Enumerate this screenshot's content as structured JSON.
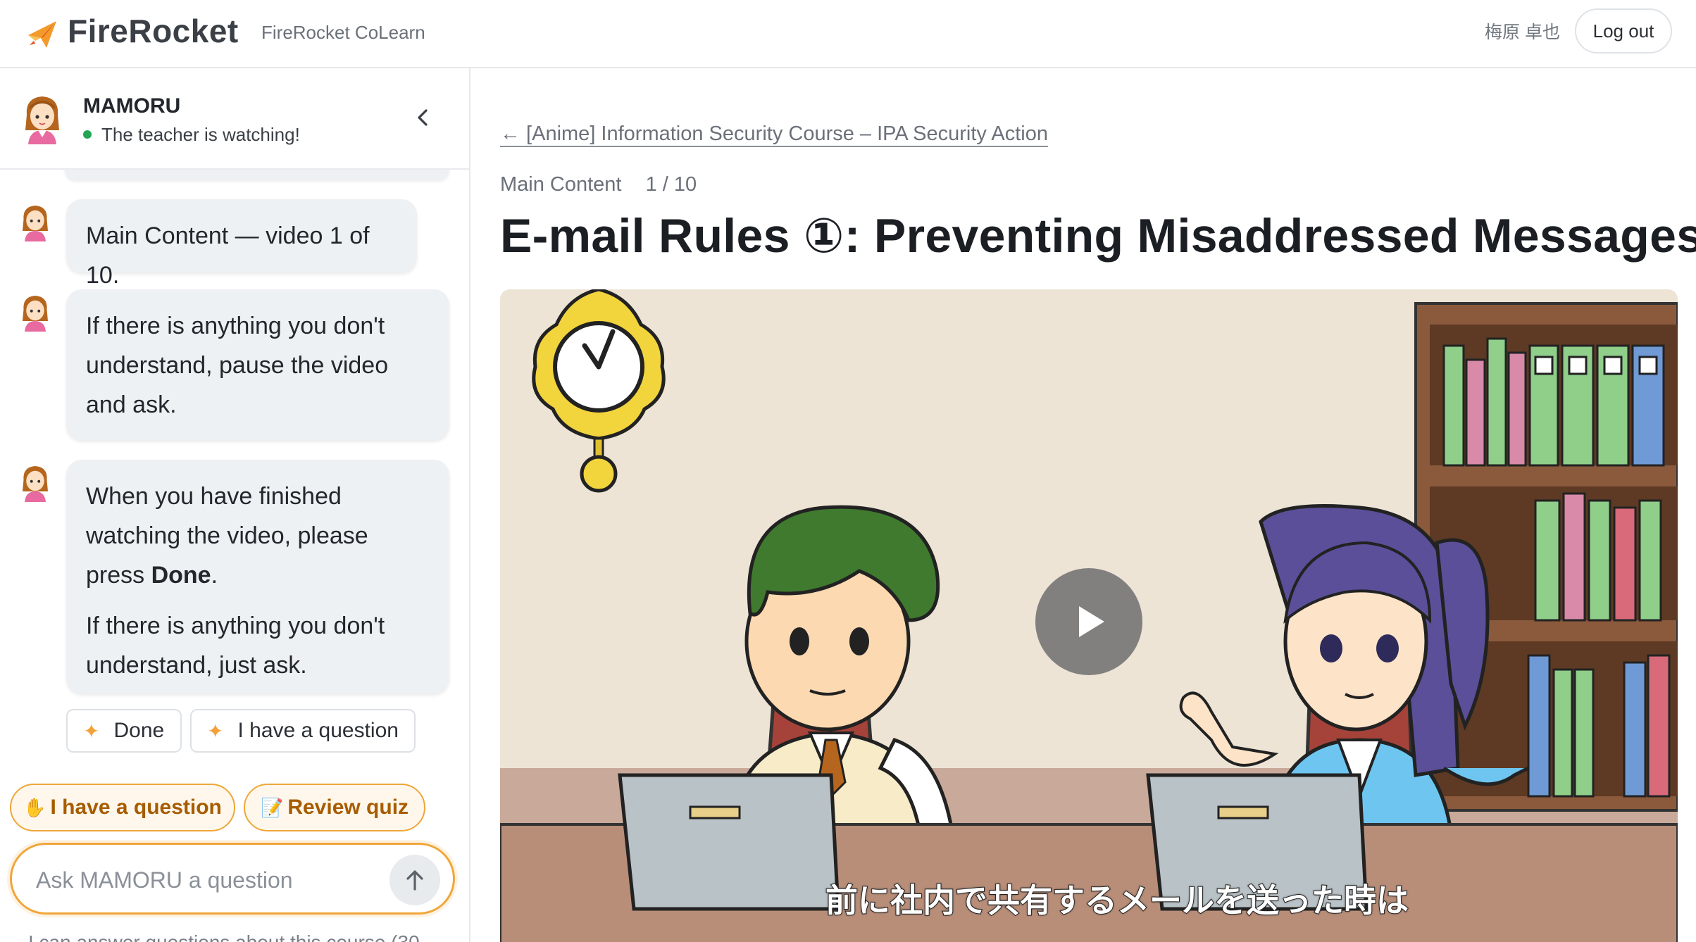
{
  "header": {
    "brand": "FireRocket",
    "subbrand": "FireRocket CoLearn",
    "user_name": "梅原 卓也",
    "logout_label": "Log out"
  },
  "sidebar": {
    "agent_name": "MAMORU",
    "agent_status": "The teacher is watching!",
    "messages": [
      {
        "text": "Main Content — video 1 of 10."
      },
      {
        "text": "If there is anything you don't understand, pause the video and ask."
      },
      {
        "line1_before": "When you have finished watching the video, please press ",
        "line1_bold": "Done",
        "line1_after": ".",
        "line2": "If there is anything you don't understand, just ask."
      }
    ],
    "choices": [
      {
        "label": "Done"
      },
      {
        "label": "I have a question"
      }
    ],
    "quick_actions": [
      {
        "emoji": "✋",
        "label": "I have a question"
      },
      {
        "emoji": "📝",
        "label": "Review quiz"
      }
    ],
    "ask_placeholder": "Ask MAMORU a question",
    "hint": "I can answer questions about this course (30"
  },
  "main": {
    "back_link": "← [Anime] Information Security Course – IPA Security Action",
    "section_label": "Main Content",
    "progress_text": "1 / 10",
    "title": "E-mail Rules ①: Preventing Misaddressed Messages",
    "video_subtitle": "前に社内で共有するメールを送った時は"
  },
  "colors": {
    "accent": "#f0a63a",
    "bubble": "#eef1f4",
    "status": "#22a653"
  }
}
